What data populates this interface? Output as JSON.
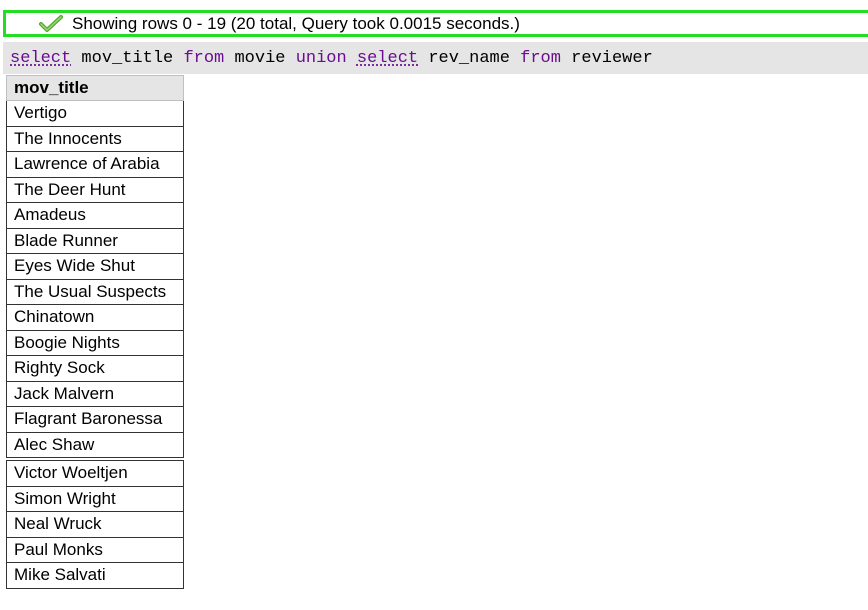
{
  "status": {
    "message": "Showing rows 0 - 19 (20 total, Query took 0.0015 seconds.)",
    "icon": "check-icon",
    "border_color": "#22dd22",
    "icon_color": "#55aa33"
  },
  "query": {
    "tokens": [
      {
        "text": "select",
        "type": "keyword",
        "link": true
      },
      {
        "text": " ",
        "type": "space"
      },
      {
        "text": "mov_title",
        "type": "identifier"
      },
      {
        "text": " ",
        "type": "space"
      },
      {
        "text": "from",
        "type": "keyword"
      },
      {
        "text": " ",
        "type": "space"
      },
      {
        "text": "movie",
        "type": "identifier"
      },
      {
        "text": " ",
        "type": "space"
      },
      {
        "text": "union",
        "type": "keyword"
      },
      {
        "text": " ",
        "type": "space"
      },
      {
        "text": "select",
        "type": "keyword",
        "link": true
      },
      {
        "text": " ",
        "type": "space"
      },
      {
        "text": "rev_name",
        "type": "identifier"
      },
      {
        "text": " ",
        "type": "space"
      },
      {
        "text": "from",
        "type": "keyword"
      },
      {
        "text": " ",
        "type": "space"
      },
      {
        "text": "reviewer",
        "type": "identifier"
      }
    ],
    "keyword_color": "#6a0d91"
  },
  "results": {
    "column_header": "mov_title",
    "rows": [
      "Vertigo",
      "The Innocents",
      "Lawrence of Arabia",
      "The Deer Hunt",
      "Amadeus",
      "Blade Runner",
      "Eyes Wide Shut",
      "The Usual Suspects",
      "Chinatown",
      "Boogie Nights",
      "Righty Sock",
      "Jack Malvern",
      "Flagrant Baronessa",
      "Alec Shaw",
      "Victor Woeltjen",
      "Simon Wright",
      "Neal Wruck",
      "Paul Monks",
      "Mike Salvati"
    ]
  }
}
